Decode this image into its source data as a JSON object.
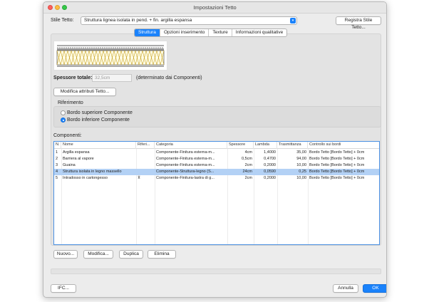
{
  "window": {
    "title": "Impostazioni Tetto"
  },
  "style": {
    "label": "Stile Tetto:",
    "value": "Struttura lignea isolata in pend. + fin. argilla espansa",
    "register_button": "Registra Stile Tetto..."
  },
  "tabs": [
    {
      "label": "Struttura",
      "active": true
    },
    {
      "label": "Opzioni inserimento",
      "active": false
    },
    {
      "label": "Texture",
      "active": false
    },
    {
      "label": "Informazioni qualitative",
      "active": false
    }
  ],
  "thickness": {
    "label": "Spessore totale:",
    "value": "32,5cm",
    "note": "(determinato dai Componenti)"
  },
  "modify_attributes_button": "Modifica attributi Tetto...",
  "reference": {
    "title": "Riferimento",
    "options": [
      {
        "label": "Bordo superiore Componente",
        "selected": false
      },
      {
        "label": "Bordo inferiore Componente",
        "selected": true
      }
    ]
  },
  "components": {
    "title": "Componenti:",
    "columns": [
      "N.",
      "Nome",
      "Riferi...",
      "Categoria",
      "Spessore",
      "Lambda",
      "Trasmittanza",
      "Controllo sui bordi"
    ],
    "rows": [
      {
        "n": "1",
        "name": "Argilla espansa",
        "ref": "",
        "category": "Componente-Finitura esterna-m...",
        "thickness": "4cm",
        "lambda": "1,4000",
        "transmittance": "35,00",
        "edge": "Bordo Tetto [Bordo Tetto] + 0cm",
        "selected": false
      },
      {
        "n": "2",
        "name": "Barriera al vapore",
        "ref": "",
        "category": "Componente-Finitura esterna-m...",
        "thickness": "0,5cm",
        "lambda": "0,4700",
        "transmittance": "94,00",
        "edge": "Bordo Tetto [Bordo Tetto] + 0cm",
        "selected": false
      },
      {
        "n": "3",
        "name": "Guaina",
        "ref": "",
        "category": "Componente-Finitura esterna-m...",
        "thickness": "2cm",
        "lambda": "0,2000",
        "transmittance": "10,00",
        "edge": "Bordo Tetto [Bordo Tetto] + 0cm",
        "selected": false
      },
      {
        "n": "4",
        "name": "Struttura isolata in legno massello",
        "ref": "",
        "category": "Componente-Struttura-legno (S...",
        "thickness": "24cm",
        "lambda": "0,0590",
        "transmittance": "0,25",
        "edge": "Bordo Tetto [Bordo Tetto] + 0cm",
        "selected": true
      },
      {
        "n": "5",
        "name": "Intradosso in cartongesso",
        "ref": "⊼",
        "category": "Componente-Finitura-lastra di g...",
        "thickness": "2cm",
        "lambda": "0,2000",
        "transmittance": "10,00",
        "edge": "Bordo Tetto [Bordo Tetto] + 0cm",
        "selected": false
      }
    ]
  },
  "row_buttons": {
    "new": "Nuovo...",
    "modify": "Modifica...",
    "duplicate": "Duplica",
    "delete": "Elimina"
  },
  "footer": {
    "ifc": "IFC...",
    "cancel": "Annulla",
    "ok": "OK"
  },
  "colors": {
    "accent": "#1a82fb",
    "selection": "#b3d1f5"
  }
}
